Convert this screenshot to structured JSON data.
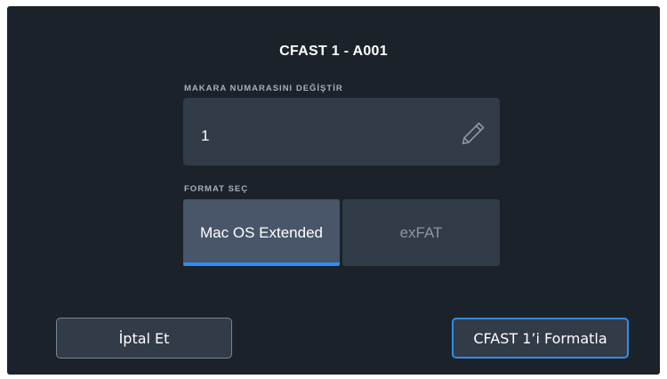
{
  "dialog": {
    "title": "CFAST 1 - A001"
  },
  "reel": {
    "label": "MAKARA NUMARASINI DEĞİŞTİR",
    "value": "1",
    "edit_icon": "pencil-icon"
  },
  "format": {
    "label": "FORMAT SEÇ",
    "options": [
      {
        "label": "Mac OS Extended",
        "selected": true
      },
      {
        "label": "exFAT",
        "selected": false
      }
    ],
    "accent_color": "#2d8df5"
  },
  "buttons": {
    "cancel_label": "İptal Et",
    "format_label": "CFAST 1’i Formatla"
  },
  "colors": {
    "background": "#1c222a",
    "field": "#323b48",
    "selected_option": "#49566a",
    "accent": "#2d8df5"
  }
}
